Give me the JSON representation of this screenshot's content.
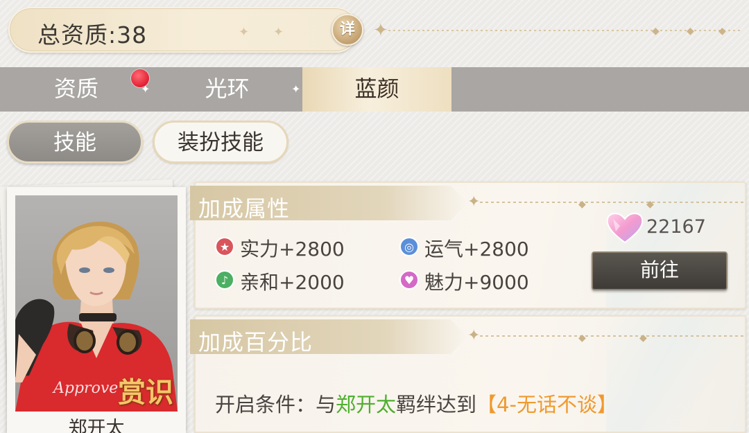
{
  "header": {
    "total_label": "总资质:38",
    "detail_button": "详"
  },
  "tabs": [
    {
      "label": "资质",
      "active": false,
      "has_badge": true
    },
    {
      "label": "光环",
      "active": false,
      "has_badge": false
    },
    {
      "label": "蓝颜",
      "active": true,
      "has_badge": false
    }
  ],
  "subtabs": [
    {
      "label": "技能",
      "active": true
    },
    {
      "label": "装扮技能",
      "active": false
    }
  ],
  "character": {
    "name": "郑开太",
    "badge": "赏识"
  },
  "bonus_attributes": {
    "title": "加成属性",
    "stats": [
      {
        "label": "实力+2800",
        "icon": "star-icon",
        "color": "#d9555c"
      },
      {
        "label": "运气+2800",
        "icon": "luck-icon",
        "color": "#5b8fd9"
      },
      {
        "label": "亲和+2000",
        "icon": "affinity-icon",
        "color": "#4caf62"
      },
      {
        "label": "魅力+9000",
        "icon": "heart-icon",
        "color": "#d469c6"
      }
    ],
    "currency_value": "22167",
    "currency_icon": "crystal-heart-icon",
    "goto_button": "前往"
  },
  "bonus_percent": {
    "title": "加成百分比",
    "condition_prefix": "开启条件：与",
    "condition_name": "郑开太",
    "condition_middle": "羁绊达到",
    "condition_level": "【4-无话不谈】"
  },
  "colors": {
    "tab_bar": "#a9a6a3",
    "active_tab": "#f1e4c8",
    "green_text": "#4fae2e",
    "orange_text": "#f0992e"
  }
}
